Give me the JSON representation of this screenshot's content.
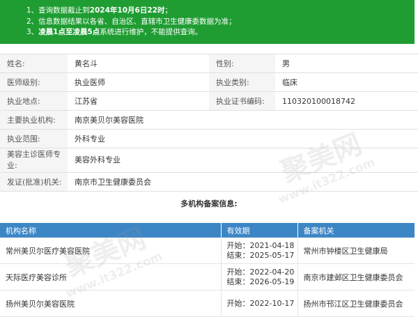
{
  "notice": {
    "l1_pre": "1、查询数据截止到",
    "l1_bold": "2024年10月6日22时",
    "l1_post": "；",
    "l2": "2、信息数据结果以各省、自治区、直辖市卫生健康委数据为准；",
    "l3_pre": "3、",
    "l3_bold": "凌晨1点至凌晨5点",
    "l3_post": "系统进行维护，不能提供查询。"
  },
  "info": {
    "name_label": "姓名:",
    "name": "黄名斗",
    "gender_label": "性别:",
    "gender": "男",
    "level_label": "医师级别:",
    "level": "执业医师",
    "category_label": "执业类别:",
    "category": "临床",
    "place_label": "执业地点:",
    "place": "江苏省",
    "cert_label": "执业证书编码:",
    "cert": "110320100018742",
    "org_label": "主要执业机构:",
    "org": "南京美贝尔美容医院",
    "scope_label": "执业范围:",
    "scope": "外科专业",
    "cosmetic_label": "美容主诊医师专业:",
    "cosmetic": "美容外科专业",
    "issuer_label": "发证(批准)机关:",
    "issuer": "南京市卫生健康委员会"
  },
  "registry": {
    "title": "多机构备案信息:",
    "headers": [
      "机构名称",
      "有效期",
      "备案机关"
    ],
    "rows": [
      {
        "org": "常州美贝尔医疗美容医院",
        "start": "开始：2021-04-18",
        "end": "结束：2025-05-17",
        "authority": "常州市钟楼区卫生健康局"
      },
      {
        "org": "天际医疗美容诊所",
        "start": "开始：2022-04-20",
        "end": "结束：2026-05-19",
        "authority": "南京市建邺区卫生健康委员会"
      },
      {
        "org": "扬州美贝尔美容医院",
        "start": "开始：2022-10-17",
        "end": "",
        "authority": "扬州市邗江区卫生健康委员会"
      }
    ]
  },
  "watermark": {
    "cn": "聚美网",
    "url": "www.it322.com"
  },
  "colors": {
    "notice_bg": "#1f9d32",
    "header_bg": "#3d86c6",
    "label_bg": "#f5f5f5"
  }
}
